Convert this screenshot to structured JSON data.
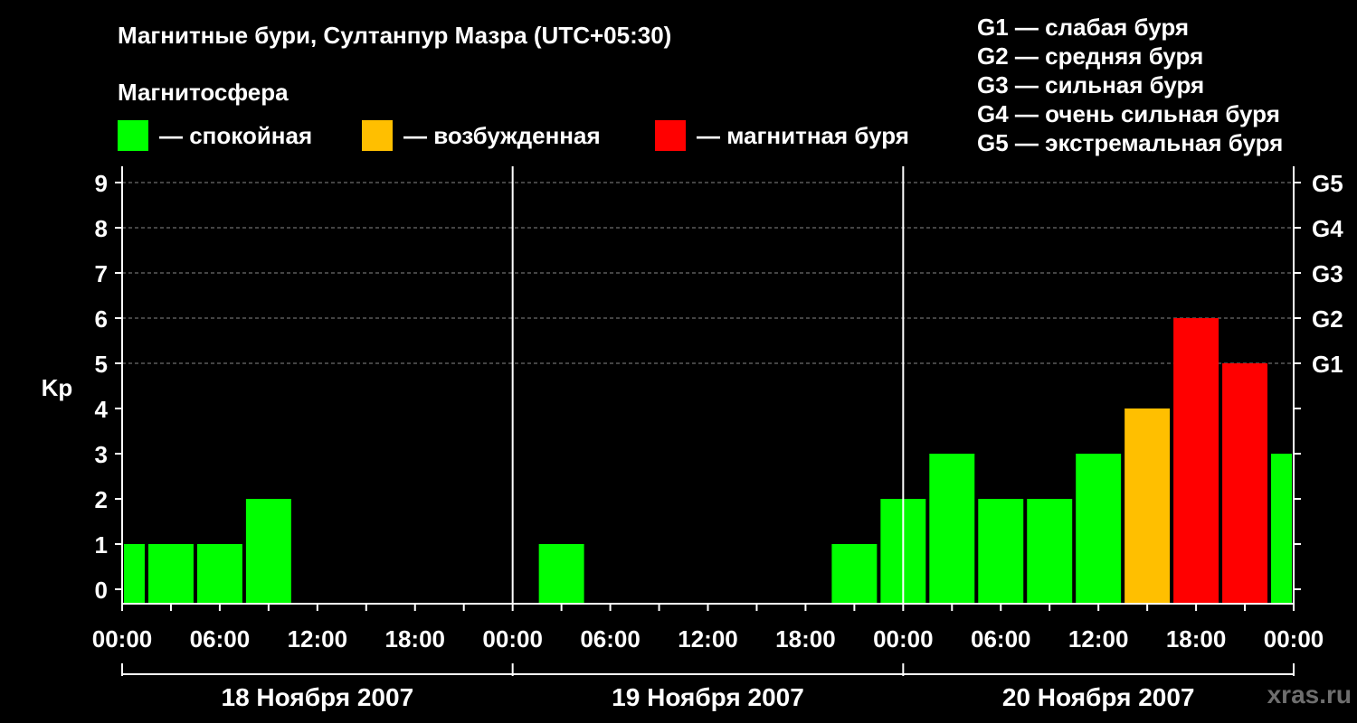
{
  "title": "Магнитные бури, Султанпур Мазра (UTC+05:30)",
  "magnetosphere_label": "Магнитосфера",
  "legend": [
    {
      "label": "— спокойная",
      "color": "#00ff00"
    },
    {
      "label": "— возбужденная",
      "color": "#ffbf00"
    },
    {
      "label": "— магнитная буря",
      "color": "#ff0000"
    }
  ],
  "g_legend": [
    "G1 — слабая буря",
    "G2 — средняя буря",
    "G3 — сильная буря",
    "G4 — очень сильная буря",
    "G5 — экстремальная буря"
  ],
  "watermark": "xras.ru",
  "chart_data": {
    "type": "bar",
    "ylabel": "Kp",
    "ylim": [
      0,
      9
    ],
    "yticks": [
      "0",
      "1",
      "2",
      "3",
      "4",
      "5",
      "6",
      "7",
      "8",
      "9"
    ],
    "right_ticks": [
      {
        "value": 5,
        "label": "G1"
      },
      {
        "value": 6,
        "label": "G2"
      },
      {
        "value": 7,
        "label": "G3"
      },
      {
        "value": 8,
        "label": "G4"
      },
      {
        "value": 9,
        "label": "G5"
      }
    ],
    "xtick_labels": [
      "00:00",
      "06:00",
      "12:00",
      "18:00",
      "00:00",
      "06:00",
      "12:00",
      "18:00",
      "00:00",
      "06:00",
      "12:00",
      "18:00",
      "00:00"
    ],
    "days": [
      "18 Ноября 2007",
      "19 Ноября 2007",
      "20 Ноября 2007"
    ],
    "grid": "horizontal dashed at 5, 6, 7, 8, 9",
    "colors": {
      "quiet": "#00ff00",
      "active": "#ffbf00",
      "storm": "#ff0000"
    },
    "bars": [
      {
        "day": "18 Ноября 2007",
        "start": "00:00",
        "end": "01:30",
        "kp": 1,
        "level": "quiet"
      },
      {
        "day": "18 Ноября 2007",
        "start": "01:30",
        "end": "04:30",
        "kp": 1,
        "level": "quiet"
      },
      {
        "day": "18 Ноября 2007",
        "start": "04:30",
        "end": "07:30",
        "kp": 1,
        "level": "quiet"
      },
      {
        "day": "18 Ноября 2007",
        "start": "07:30",
        "end": "10:30",
        "kp": 2,
        "level": "quiet"
      },
      {
        "day": "18 Ноября 2007",
        "start": "10:30",
        "end": "13:30",
        "kp": 0,
        "level": "quiet"
      },
      {
        "day": "18 Ноября 2007",
        "start": "13:30",
        "end": "16:30",
        "kp": 0,
        "level": "quiet"
      },
      {
        "day": "18 Ноября 2007",
        "start": "16:30",
        "end": "19:30",
        "kp": 0,
        "level": "quiet"
      },
      {
        "day": "18 Ноября 2007",
        "start": "19:30",
        "end": "22:30",
        "kp": 0,
        "level": "quiet"
      },
      {
        "day": "18 Ноября 2007",
        "start": "22:30",
        "end": "01:30",
        "kp": 0,
        "level": "quiet"
      },
      {
        "day": "19 Ноября 2007",
        "start": "01:30",
        "end": "04:30",
        "kp": 1,
        "level": "quiet"
      },
      {
        "day": "19 Ноября 2007",
        "start": "04:30",
        "end": "07:30",
        "kp": 0,
        "level": "quiet"
      },
      {
        "day": "19 Ноября 2007",
        "start": "07:30",
        "end": "10:30",
        "kp": 0,
        "level": "quiet"
      },
      {
        "day": "19 Ноября 2007",
        "start": "10:30",
        "end": "13:30",
        "kp": 0,
        "level": "quiet"
      },
      {
        "day": "19 Ноября 2007",
        "start": "13:30",
        "end": "16:30",
        "kp": 0,
        "level": "quiet"
      },
      {
        "day": "19 Ноября 2007",
        "start": "16:30",
        "end": "19:30",
        "kp": 0,
        "level": "quiet"
      },
      {
        "day": "19 Ноября 2007",
        "start": "19:30",
        "end": "22:30",
        "kp": 1,
        "level": "quiet"
      },
      {
        "day": "19 Ноября 2007",
        "start": "22:30",
        "end": "01:30",
        "kp": 2,
        "level": "quiet"
      },
      {
        "day": "20 Ноября 2007",
        "start": "01:30",
        "end": "04:30",
        "kp": 3,
        "level": "quiet"
      },
      {
        "day": "20 Ноября 2007",
        "start": "04:30",
        "end": "07:30",
        "kp": 2,
        "level": "quiet"
      },
      {
        "day": "20 Ноября 2007",
        "start": "07:30",
        "end": "10:30",
        "kp": 2,
        "level": "quiet"
      },
      {
        "day": "20 Ноября 2007",
        "start": "10:30",
        "end": "13:30",
        "kp": 3,
        "level": "quiet"
      },
      {
        "day": "20 Ноября 2007",
        "start": "13:30",
        "end": "16:30",
        "kp": 4,
        "level": "active"
      },
      {
        "day": "20 Ноября 2007",
        "start": "16:30",
        "end": "19:30",
        "kp": 6,
        "level": "storm"
      },
      {
        "day": "20 Ноября 2007",
        "start": "19:30",
        "end": "22:30",
        "kp": 5,
        "level": "storm"
      },
      {
        "day": "20 Ноября 2007",
        "start": "22:30",
        "end": "24:00",
        "kp": 3,
        "level": "quiet"
      }
    ]
  }
}
